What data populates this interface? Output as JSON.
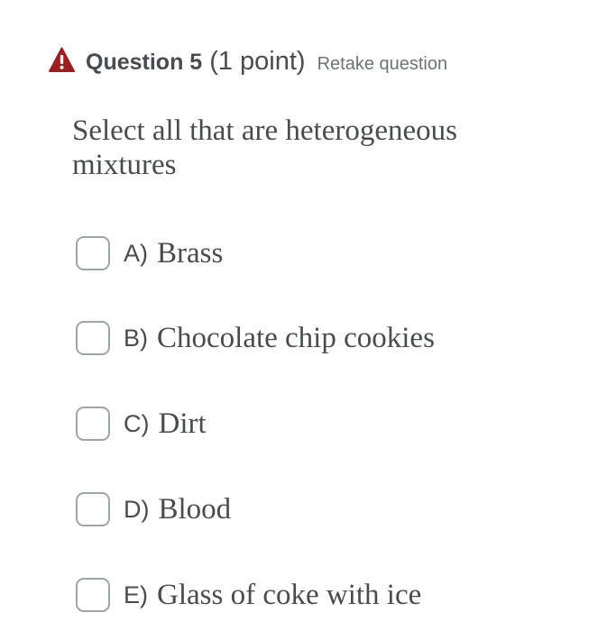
{
  "question": {
    "title": "Question 5",
    "points": "(1 point)",
    "retake_label": "Retake question",
    "prompt": "Select all that are heterogeneous mixtures",
    "warning_icon": "warning-triangle-icon",
    "warning_color": "#9c1e1e",
    "options": [
      {
        "letter": "A)",
        "text": "Brass",
        "checked": false
      },
      {
        "letter": "B)",
        "text": "Chocolate chip cookies",
        "checked": false
      },
      {
        "letter": "C)",
        "text": "Dirt",
        "checked": false
      },
      {
        "letter": "D)",
        "text": "Blood",
        "checked": false
      },
      {
        "letter": "E)",
        "text": "Glass of coke with ice",
        "checked": false
      }
    ]
  }
}
